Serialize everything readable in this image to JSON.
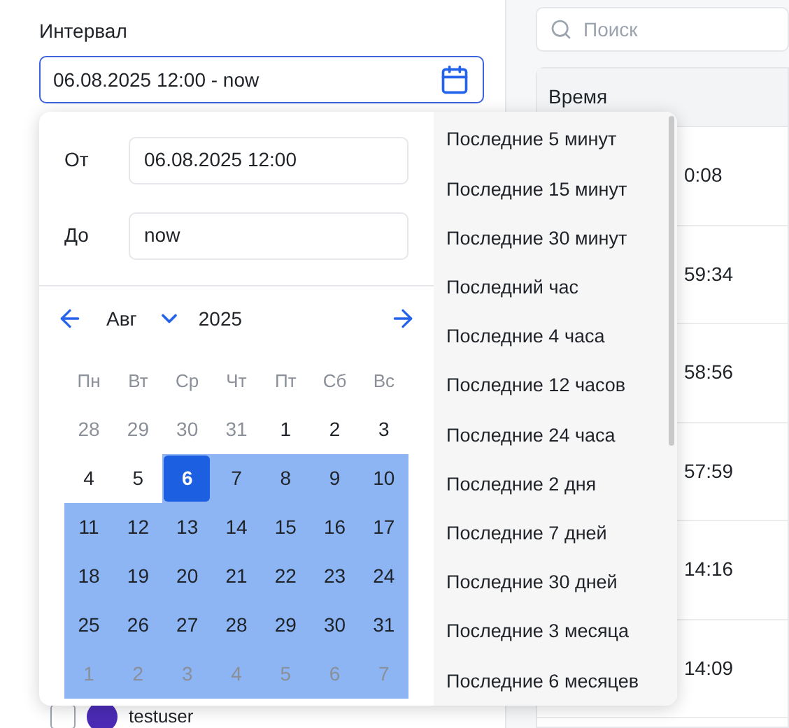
{
  "interval": {
    "label": "Интервал",
    "value": "06.08.2025 12:00 - now"
  },
  "picker": {
    "from": {
      "label": "От",
      "value": "06.08.2025 12:00"
    },
    "to": {
      "label": "До",
      "value": "now"
    },
    "month": "Авг",
    "year": "2025",
    "weekdays": [
      "Пн",
      "Вт",
      "Ср",
      "Чт",
      "Пт",
      "Сб",
      "Вс"
    ],
    "days": [
      {
        "label": "28",
        "muted": true,
        "in_range": false,
        "selected": false
      },
      {
        "label": "29",
        "muted": true,
        "in_range": false,
        "selected": false
      },
      {
        "label": "30",
        "muted": true,
        "in_range": false,
        "selected": false
      },
      {
        "label": "31",
        "muted": true,
        "in_range": false,
        "selected": false
      },
      {
        "label": "1",
        "muted": false,
        "in_range": false,
        "selected": false
      },
      {
        "label": "2",
        "muted": false,
        "in_range": false,
        "selected": false
      },
      {
        "label": "3",
        "muted": false,
        "in_range": false,
        "selected": false
      },
      {
        "label": "4",
        "muted": false,
        "in_range": false,
        "selected": false
      },
      {
        "label": "5",
        "muted": false,
        "in_range": false,
        "selected": false
      },
      {
        "label": "6",
        "muted": false,
        "in_range": true,
        "selected": true
      },
      {
        "label": "7",
        "muted": false,
        "in_range": true,
        "selected": false
      },
      {
        "label": "8",
        "muted": false,
        "in_range": true,
        "selected": false
      },
      {
        "label": "9",
        "muted": false,
        "in_range": true,
        "selected": false
      },
      {
        "label": "10",
        "muted": false,
        "in_range": true,
        "selected": false
      },
      {
        "label": "11",
        "muted": false,
        "in_range": true,
        "selected": false
      },
      {
        "label": "12",
        "muted": false,
        "in_range": true,
        "selected": false
      },
      {
        "label": "13",
        "muted": false,
        "in_range": true,
        "selected": false
      },
      {
        "label": "14",
        "muted": false,
        "in_range": true,
        "selected": false
      },
      {
        "label": "15",
        "muted": false,
        "in_range": true,
        "selected": false
      },
      {
        "label": "16",
        "muted": false,
        "in_range": true,
        "selected": false
      },
      {
        "label": "17",
        "muted": false,
        "in_range": true,
        "selected": false
      },
      {
        "label": "18",
        "muted": false,
        "in_range": true,
        "selected": false
      },
      {
        "label": "19",
        "muted": false,
        "in_range": true,
        "selected": false
      },
      {
        "label": "20",
        "muted": false,
        "in_range": true,
        "selected": false
      },
      {
        "label": "21",
        "muted": false,
        "in_range": true,
        "selected": false
      },
      {
        "label": "22",
        "muted": false,
        "in_range": true,
        "selected": false
      },
      {
        "label": "23",
        "muted": false,
        "in_range": true,
        "selected": false
      },
      {
        "label": "24",
        "muted": false,
        "in_range": true,
        "selected": false
      },
      {
        "label": "25",
        "muted": false,
        "in_range": true,
        "selected": false
      },
      {
        "label": "26",
        "muted": false,
        "in_range": true,
        "selected": false
      },
      {
        "label": "27",
        "muted": false,
        "in_range": true,
        "selected": false
      },
      {
        "label": "28",
        "muted": false,
        "in_range": true,
        "selected": false
      },
      {
        "label": "29",
        "muted": false,
        "in_range": true,
        "selected": false
      },
      {
        "label": "30",
        "muted": false,
        "in_range": true,
        "selected": false
      },
      {
        "label": "31",
        "muted": false,
        "in_range": true,
        "selected": false
      },
      {
        "label": "1",
        "muted": true,
        "in_range": true,
        "selected": false
      },
      {
        "label": "2",
        "muted": true,
        "in_range": true,
        "selected": false
      },
      {
        "label": "3",
        "muted": true,
        "in_range": true,
        "selected": false
      },
      {
        "label": "4",
        "muted": true,
        "in_range": true,
        "selected": false
      },
      {
        "label": "5",
        "muted": true,
        "in_range": true,
        "selected": false
      },
      {
        "label": "6",
        "muted": true,
        "in_range": true,
        "selected": false
      },
      {
        "label": "7",
        "muted": true,
        "in_range": true,
        "selected": false
      }
    ],
    "presets": [
      "Последние 5 минут",
      "Последние 15 минут",
      "Последние 30 минут",
      "Последний час",
      "Последние 4 часа",
      "Последние 12 часов",
      "Последние 24 часа",
      "Последние 2 дня",
      "Последние 7 дней",
      "Последние 30 дней",
      "Последние 3 месяца",
      "Последние 6 месяцев"
    ]
  },
  "user_row": {
    "name": "testuser",
    "checked": false
  },
  "search": {
    "placeholder": "Поиск"
  },
  "table": {
    "columns": [
      "Время"
    ],
    "rows": [
      "0:08",
      "59:34",
      "58:56",
      "57:59",
      "14:16",
      "14:09"
    ]
  }
}
